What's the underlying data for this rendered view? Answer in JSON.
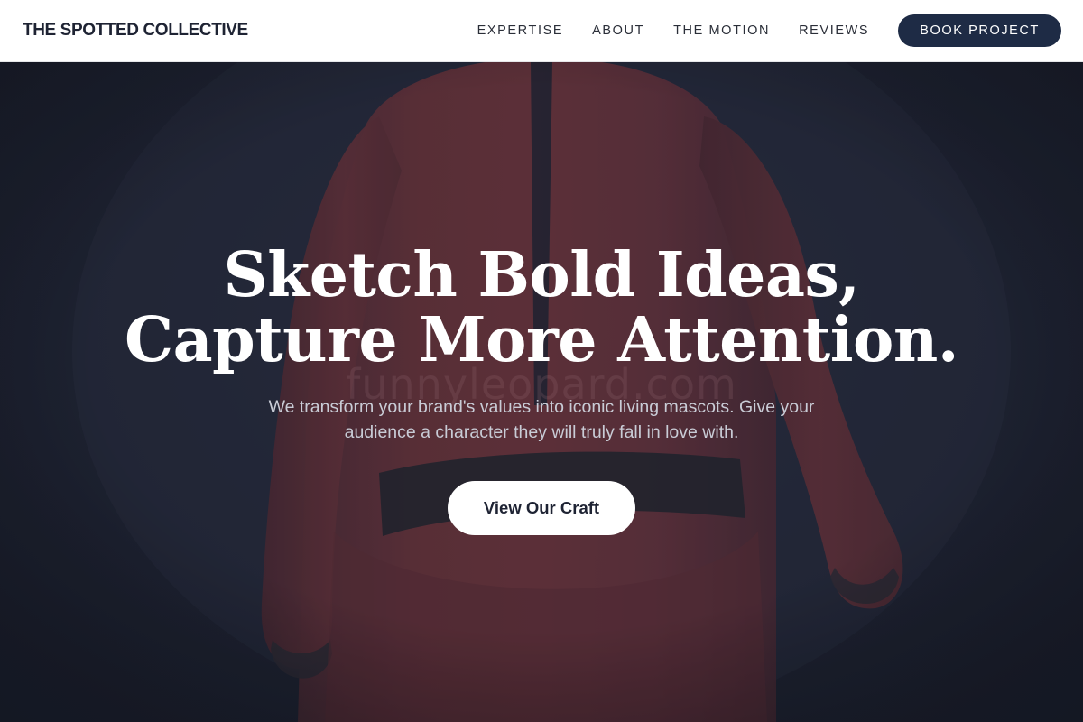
{
  "nav": {
    "brand": "THE SPOTTED COLLECTIVE",
    "links": [
      {
        "label": "EXPERTISE"
      },
      {
        "label": "ABOUT"
      },
      {
        "label": "THE MOTION"
      },
      {
        "label": "REVIEWS"
      }
    ],
    "cta_label": "BOOK PROJECT"
  },
  "hero": {
    "title_line1": "Sketch Bold Ideas,",
    "title_line2": "Capture More Attention.",
    "subtitle": "We transform your brand's values into iconic living mascots. Give your audience a character they will truly fall in love with.",
    "cta_label": "View Our Craft",
    "watermark": "funnyleopard.com",
    "background_image": "mascot-costume-back-view"
  },
  "colors": {
    "nav_bg": "#ffffff",
    "brand_text": "#1e2333",
    "book_button_bg": "#1e2b45",
    "hero_bg": "#1e2231",
    "costume_red": "#6b3238",
    "title_text": "#ffffff",
    "subtitle_text": "#c9ccd6"
  }
}
